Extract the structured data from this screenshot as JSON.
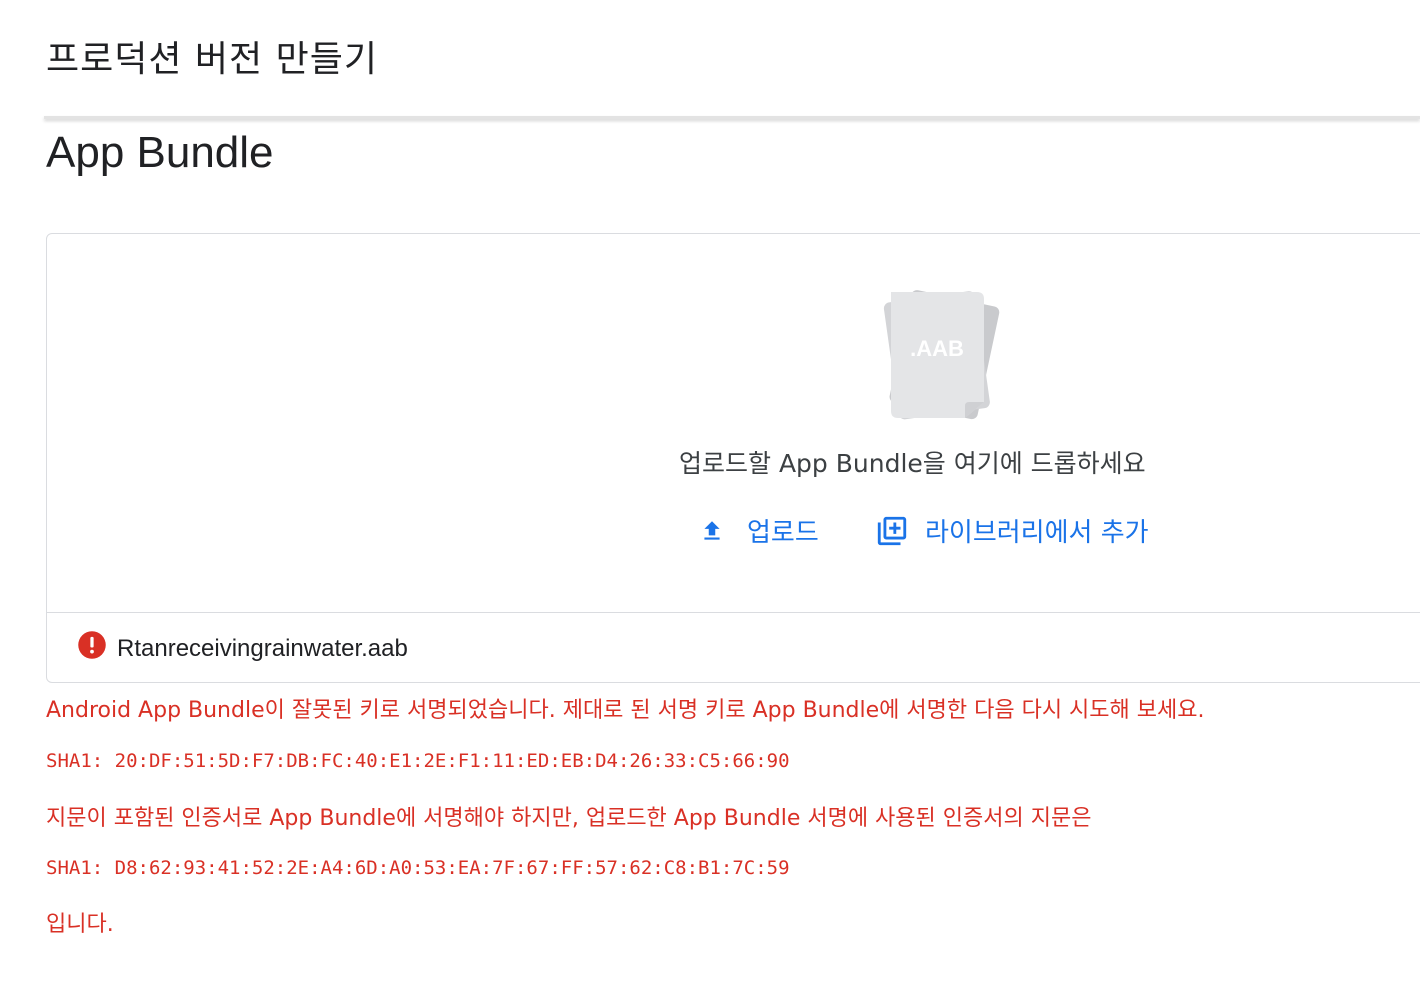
{
  "header": {
    "title": "프로덕션 버전 만들기"
  },
  "section": {
    "title": "App Bundle"
  },
  "upload": {
    "file_badge": ".AAB",
    "drop_text": "업로드할 App Bundle을 여기에 드롭하세요",
    "upload_label": "업로드",
    "library_label": "라이브러리에서 추가",
    "icons": {
      "upload": "upload-icon",
      "library": "library-add-icon",
      "file": "aab-file-icon",
      "error": "error-icon"
    },
    "accent_color": "#1a73e8"
  },
  "file": {
    "name": "Rtanreceivingrainwater.aab",
    "status_color": "#d93025"
  },
  "errors": {
    "message": "Android App Bundle이 잘못된 키로 서명되었습니다. 제대로 된 서명 키로 App Bundle에 서명한 다음 다시 시도해 보세요.",
    "expected_sha1": "SHA1: 20:DF:51:5D:F7:DB:FC:40:E1:2E:F1:11:ED:EB:D4:26:33:C5:66:90",
    "fingerprint_message": "지문이 포함된 인증서로 App Bundle에 서명해야 하지만, 업로드한 App Bundle 서명에 사용된 인증서의 지문은",
    "actual_sha1": "SHA1: D8:62:93:41:52:2E:A4:6D:A0:53:EA:7F:67:FF:57:62:C8:B1:7C:59",
    "suffix": "입니다."
  }
}
